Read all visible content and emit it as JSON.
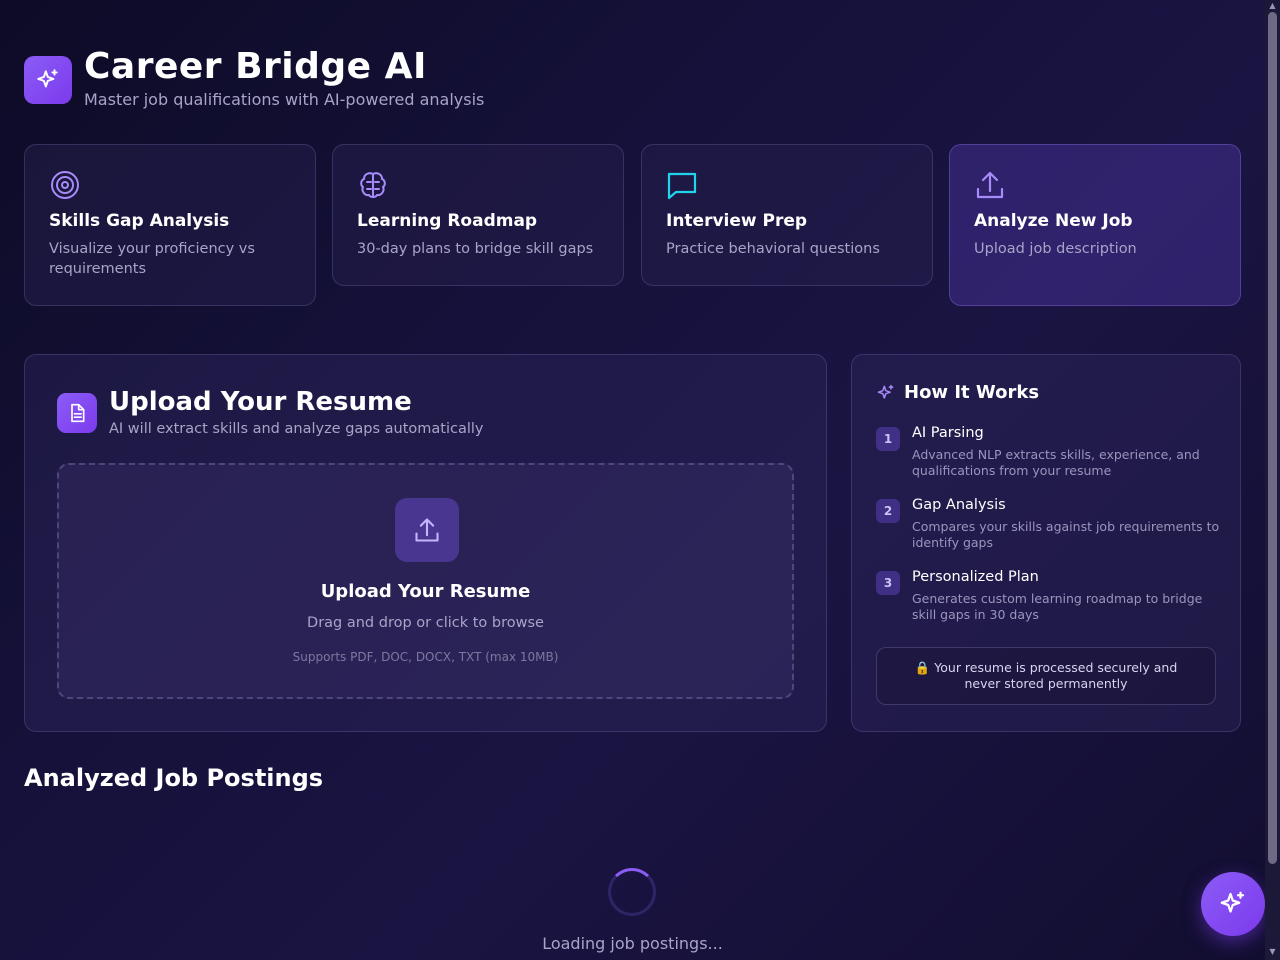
{
  "header": {
    "logo_icon": "sparkles-icon",
    "title": "Career Bridge AI",
    "subtitle": "Master job qualifications with AI-powered analysis"
  },
  "features": [
    {
      "icon": "target-icon",
      "title": "Skills Gap Analysis",
      "desc": "Visualize your proficiency vs requirements"
    },
    {
      "icon": "brain-icon",
      "title": "Learning Roadmap",
      "desc": "30-day plans to bridge skill gaps"
    },
    {
      "icon": "message-icon",
      "title": "Interview Prep",
      "desc": "Practice behavioral questions"
    },
    {
      "icon": "upload-icon",
      "title": "Analyze New Job",
      "desc": "Upload job description"
    }
  ],
  "upload": {
    "title": "Upload Your Resume",
    "subtitle": "AI will extract skills and analyze gaps automatically",
    "dropzone_title": "Upload Your Resume",
    "dropzone_sub": "Drag and drop or click to browse",
    "dropzone_note": "Supports PDF, DOC, DOCX, TXT (max 10MB)"
  },
  "how_it_works": {
    "title": "How It Works",
    "steps": [
      {
        "num": "1",
        "title": "AI Parsing",
        "desc": "Advanced NLP extracts skills, experience, and qualifications from your resume"
      },
      {
        "num": "2",
        "title": "Gap Analysis",
        "desc": "Compares your skills against job requirements to identify gaps"
      },
      {
        "num": "3",
        "title": "Personalized Plan",
        "desc": "Generates custom learning roadmap to bridge skill gaps in 30 days"
      }
    ],
    "secure_note": "🔒 Your resume is processed securely and never stored permanently"
  },
  "postings": {
    "title": "Analyzed Job Postings",
    "loading": "Loading job postings..."
  },
  "colors": {
    "accent": "#8b5cf6",
    "accent_dark": "#7c3aed",
    "background": "#15113a",
    "muted_text": "#a8a4c8",
    "cyan_icon": "#22d3ee"
  }
}
